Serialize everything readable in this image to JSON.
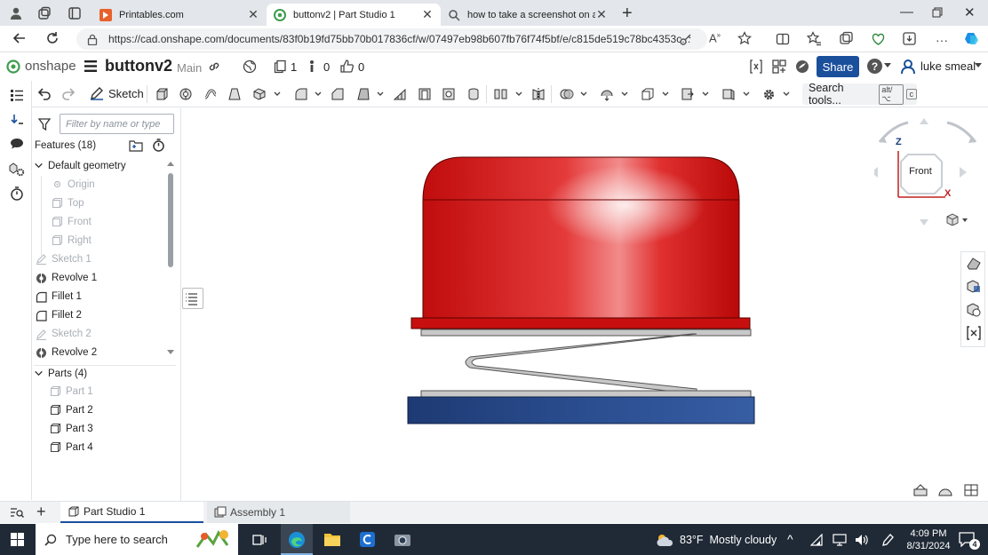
{
  "browser": {
    "tabs": [
      {
        "title": "Printables.com",
        "active": false
      },
      {
        "title": "buttonv2 | Part Studio 1",
        "active": true
      },
      {
        "title": "how to take a screenshot on an a",
        "active": false
      }
    ],
    "url": "https://cad.onshape.com/documents/83f0b19fd75bb70b017836cf/w/07497eb98b607fb76f74f5bf/e/c815de519c78bc4353c..."
  },
  "app": {
    "brand": "onshape",
    "doc_title": "buttonv2",
    "branch": "Main",
    "versions_count": "1",
    "info_count": "0",
    "likes_count": "0",
    "share_label": "Share",
    "help_label": "?",
    "user_name": "luke smeal"
  },
  "toolbar": {
    "sketch_label": "Sketch",
    "search_label": "Search tools...",
    "search_shortcut": "alt/⌥",
    "search_key": "c"
  },
  "features": {
    "filter_placeholder": "Filter by name or type",
    "header": "Features (18)",
    "default_geometry": "Default geometry",
    "items": [
      {
        "label": "Origin",
        "icon": "origin-icon",
        "dim": true
      },
      {
        "label": "Top",
        "icon": "plane-icon",
        "dim": true
      },
      {
        "label": "Front",
        "icon": "plane-icon",
        "dim": true
      },
      {
        "label": "Right",
        "icon": "plane-icon",
        "dim": true
      },
      {
        "label": "Sketch 1",
        "icon": "sketch-icon",
        "dim": true
      },
      {
        "label": "Revolve 1",
        "icon": "revolve-icon",
        "dim": false
      },
      {
        "label": "Fillet 1",
        "icon": "fillet-icon",
        "dim": false
      },
      {
        "label": "Fillet 2",
        "icon": "fillet-icon",
        "dim": false
      },
      {
        "label": "Sketch 2",
        "icon": "sketch-icon",
        "dim": true
      },
      {
        "label": "Revolve 2",
        "icon": "revolve-icon",
        "dim": false
      }
    ],
    "parts_header": "Parts (4)",
    "parts": [
      {
        "label": "Part 1",
        "dim": true
      },
      {
        "label": "Part 2",
        "dim": false
      },
      {
        "label": "Part 3",
        "dim": false
      },
      {
        "label": "Part 4",
        "dim": false
      }
    ]
  },
  "viewcube": {
    "face": "Front",
    "z_label": "Z",
    "x_label": "X"
  },
  "bottom_tabs": [
    {
      "label": "Part Studio 1",
      "active": true
    },
    {
      "label": "Assembly 1",
      "active": false
    }
  ],
  "taskbar": {
    "search_placeholder": "Type here to search",
    "weather": "83°F  Mostly cloudy",
    "time": "4:09 PM",
    "date": "8/31/2024",
    "notifications": "4"
  },
  "colors": {
    "accent": "#1a4f9c",
    "button_red": "#d01010",
    "base_blue": "#2a4d8f",
    "spring": "#c8c8c8"
  }
}
